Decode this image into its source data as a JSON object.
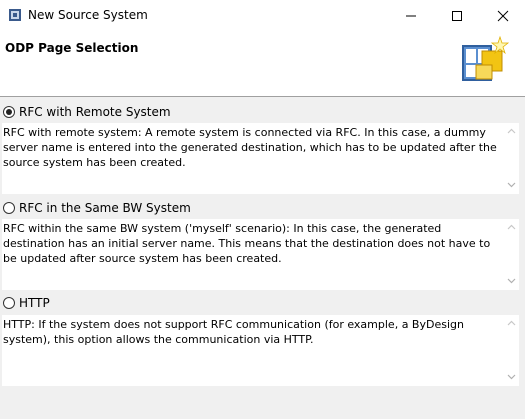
{
  "window": {
    "title": "New Source System"
  },
  "header": {
    "page_title": "ODP Page Selection"
  },
  "options": [
    {
      "label": "RFC with Remote System",
      "selected": true,
      "description": "RFC with remote system: A remote system is connected via RFC. In this case, a dummy server name is entered into the generated destination, which has to be updated after the source system has been created."
    },
    {
      "label": "RFC in the Same BW System",
      "selected": false,
      "description": "RFC within the same BW system ('myself' scenario): In this case, the generated destination has an initial server name. This means that the destination does not have to be updated after source system has been created."
    },
    {
      "label": "HTTP",
      "selected": false,
      "description": "HTTP: If the system does not support RFC communication (for example, a ByDesign system), this option allows the communication via HTTP."
    }
  ]
}
